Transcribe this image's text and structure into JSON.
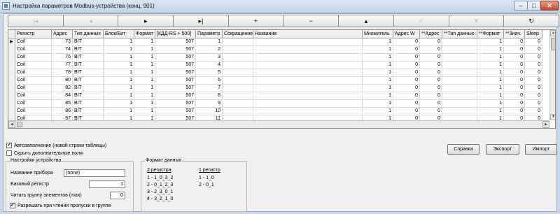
{
  "window": {
    "title": "Настройка параметров Modbus-устройства (конц. 901)",
    "min": "–",
    "max": "□",
    "close": "✕"
  },
  "navbar": {
    "buttons": [
      {
        "name": "first-record-button",
        "glyph": "|◂",
        "enabled": false
      },
      {
        "name": "prior-record-button",
        "glyph": "◂",
        "enabled": false
      },
      {
        "name": "next-record-button",
        "glyph": "▸",
        "enabled": true
      },
      {
        "name": "last-record-button",
        "glyph": "▸|",
        "enabled": true
      },
      {
        "name": "insert-record-button",
        "glyph": "+",
        "enabled": true
      },
      {
        "name": "delete-record-button",
        "glyph": "−",
        "enabled": true
      },
      {
        "name": "edit-record-button",
        "glyph": "▴",
        "enabled": true
      },
      {
        "name": "post-record-button",
        "glyph": "✓",
        "enabled": false
      },
      {
        "name": "cancel-record-button",
        "glyph": "✕",
        "enabled": false
      },
      {
        "name": "refresh-button",
        "glyph": "↻",
        "enabled": true
      }
    ]
  },
  "grid": {
    "columns": [
      "Регистр",
      "Адрес",
      "Тип данных",
      "Блок/Бит",
      "Формат",
      "[КДД-RS + 500]",
      "Параметр",
      "Сокращение",
      "Название",
      "Множитель",
      "Адрес W",
      "**Адрес",
      "**Тип данных",
      "**Формат",
      "**Знач.",
      "Sleep"
    ],
    "current_row_marker": "▶",
    "rows": [
      [
        "Coil",
        "73",
        "BIT",
        "1",
        "1",
        "507",
        "1",
        "",
        "",
        "1",
        "0",
        "0",
        "",
        "1",
        "0",
        "0"
      ],
      [
        "Coil",
        "74",
        "BIT",
        "1",
        "1",
        "507",
        "2",
        "",
        "",
        "1",
        "0",
        "0",
        "",
        "1",
        "0",
        "0"
      ],
      [
        "Coil",
        "76",
        "BIT",
        "1",
        "1",
        "507",
        "3",
        "",
        "",
        "1",
        "0",
        "0",
        "",
        "1",
        "0",
        "0"
      ],
      [
        "Coil",
        "77",
        "BIT",
        "1",
        "1",
        "507",
        "4",
        "",
        "",
        "1",
        "0",
        "0",
        "",
        "1",
        "0",
        "0"
      ],
      [
        "Coil",
        "78",
        "BIT",
        "1",
        "1",
        "507",
        "5",
        "",
        "",
        "1",
        "0",
        "0",
        "",
        "1",
        "0",
        "0"
      ],
      [
        "Coil",
        "80",
        "BIT",
        "1",
        "1",
        "507",
        "6",
        "",
        "",
        "1",
        "0",
        "0",
        "",
        "1",
        "0",
        "0"
      ],
      [
        "Coil",
        "82",
        "BIT",
        "1",
        "1",
        "507",
        "7",
        "",
        "",
        "1",
        "0",
        "0",
        "",
        "1",
        "0",
        "0"
      ],
      [
        "Coil",
        "84",
        "BIT",
        "1",
        "1",
        "507",
        "8",
        "",
        "",
        "1",
        "0",
        "0",
        "",
        "1",
        "0",
        "0"
      ],
      [
        "Coil",
        "85",
        "BIT",
        "1",
        "1",
        "507",
        "9",
        "",
        "",
        "1",
        "0",
        "0",
        "",
        "1",
        "0",
        "0"
      ],
      [
        "Coil",
        "86",
        "BIT",
        "1",
        "1",
        "507",
        "10",
        "",
        "",
        "1",
        "0",
        "0",
        "",
        "1",
        "0",
        "0"
      ],
      [
        "Coil",
        "87",
        "BIT",
        "1",
        "1",
        "507",
        "11",
        "",
        "",
        "1",
        "0",
        "0",
        "",
        "1",
        "0",
        "0"
      ]
    ]
  },
  "options": {
    "autofill": {
      "label": "Автозаполнение (новой строки таблицы)",
      "checked": true
    },
    "hide_extra": {
      "label": "Скрыть дополнительные поля",
      "checked": false
    }
  },
  "buttons": {
    "help": "Справка",
    "export": "Экспорт",
    "import": "Импорт"
  },
  "device_settings": {
    "legend": "Настройки устройства",
    "name_label": "Название прибора",
    "name_value": "(none)",
    "base_register_label": "Базовый регистр",
    "base_register_value": "1",
    "read_group_label": "Читать группу элементов (max)",
    "read_group_value": "0",
    "allow_gaps": {
      "label": "Разрешать при чтении пропуски в группе",
      "checked": true
    }
  },
  "data_format": {
    "legend": "Формат данных",
    "col1_header": "2 регистра",
    "col1_items": [
      "1 - 1_0_3_2",
      "2 - 0_1_2_3",
      "3 - 2_3_0_1",
      "4 - 3_2_1_0"
    ],
    "col2_header": "1 регистр",
    "col2_items": [
      "1 - 1_0",
      "2 - 0_1"
    ]
  }
}
